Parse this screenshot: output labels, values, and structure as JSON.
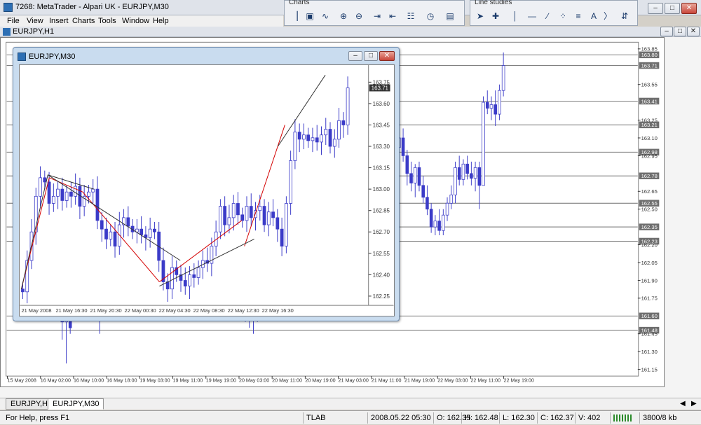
{
  "app": {
    "title": "7268: MetaTrader - Alpari UK - EURJPY,M30"
  },
  "menu": [
    "File",
    "View",
    "Insert",
    "Charts",
    "Tools",
    "Window",
    "Help"
  ],
  "toolbars": {
    "charts_title": "Charts",
    "line_studies_title": "Line studies",
    "charts_icons": [
      "bar-chart-icon",
      "candles-icon",
      "line-chart-icon",
      "zoom-in-icon",
      "zoom-out-icon",
      "tile-icon",
      "autoscroll-icon",
      "indicators-icon",
      "periods-icon",
      "templates-icon"
    ],
    "line_icons": [
      "cursor-icon",
      "crosshair-icon",
      "vertical-line-icon",
      "horizontal-line-icon",
      "trendline-icon",
      "channel-icon",
      "fibonacci-icon",
      "text-icon",
      "label-icon",
      "arrows-icon"
    ]
  },
  "bg_chart": {
    "window_title": "EURJPY,H1",
    "price_labels": [
      "163.85",
      "163.80",
      "163.71",
      "163.55",
      "163.41",
      "163.25",
      "163.21",
      "163.10",
      "162.98",
      "162.95",
      "162.78",
      "162.65",
      "162.55",
      "162.50",
      "162.35",
      "162.23",
      "162.20",
      "162.05",
      "161.90",
      "161.75",
      "161.60",
      "161.48",
      "161.45",
      "161.30",
      "161.15"
    ],
    "highlighted_prices": [
      "163.80",
      "163.71",
      "163.41",
      "163.21",
      "162.98",
      "162.78",
      "162.55",
      "162.35",
      "162.23",
      "161.60",
      "161.48"
    ],
    "time_labels": [
      "15 May 2008",
      "16 May 02:00",
      "16 May 10:00",
      "16 May 18:00",
      "19 May 03:00",
      "19 May 11:00",
      "19 May 19:00",
      "20 May 03:00",
      "20 May 11:00",
      "20 May 19:00",
      "21 May 03:00",
      "21 May 11:00",
      "21 May 19:00",
      "22 May 03:00",
      "22 May 11:00",
      "22 May 19:00"
    ]
  },
  "inner_chart": {
    "window_title": "EURJPY,M30",
    "price_labels": [
      "163.75",
      "163.71",
      "163.60",
      "163.45",
      "163.30",
      "163.15",
      "163.00",
      "162.85",
      "162.70",
      "162.55",
      "162.40",
      "162.25"
    ],
    "current_price": "163.71",
    "time_labels": [
      "21 May 2008",
      "21 May 16:30",
      "21 May 20:30",
      "22 May 00:30",
      "22 May 04:30",
      "22 May 08:30",
      "22 May 12:30",
      "22 May 16:30"
    ]
  },
  "tabs": [
    "EURJPY,H1",
    "EURJPY,M30"
  ],
  "active_tab": "EURJPY,M30",
  "status": {
    "help": "For Help, press F1",
    "profile": "TLAB",
    "datetime": "2008.05.22 05:30",
    "open": "O: 162.35",
    "high": "H: 162.48",
    "low": "L: 162.30",
    "close": "C: 162.37",
    "volume": "V: 402",
    "traffic": "3800/8 kb"
  },
  "colors": {
    "candle": "#3b3bc8",
    "trend_red": "#d40000",
    "trend_black": "#333333",
    "price_line": "#6e6e6e"
  }
}
